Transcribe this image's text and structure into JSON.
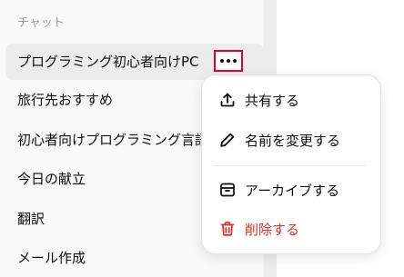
{
  "sidebar": {
    "section_title": "チャット",
    "items": [
      {
        "label": "プログラミング初心者向けPC"
      },
      {
        "label": "旅行先おすすめ"
      },
      {
        "label": "初心者向けプログラミング言語"
      },
      {
        "label": "今日の献立"
      },
      {
        "label": "翻訳"
      },
      {
        "label": "メール作成"
      }
    ],
    "active_index": 0
  },
  "more_button": {
    "icon": "ellipsis-icon",
    "highlight_color": "#e1002d"
  },
  "menu": {
    "items": [
      {
        "label": "共有する",
        "icon": "share-icon"
      },
      {
        "label": "名前を変更する",
        "icon": "pencil-icon"
      },
      {
        "label": "アーカイブする",
        "icon": "archive-icon"
      },
      {
        "label": "削除する",
        "icon": "trash-icon",
        "color": "#e02e2a"
      }
    ]
  }
}
